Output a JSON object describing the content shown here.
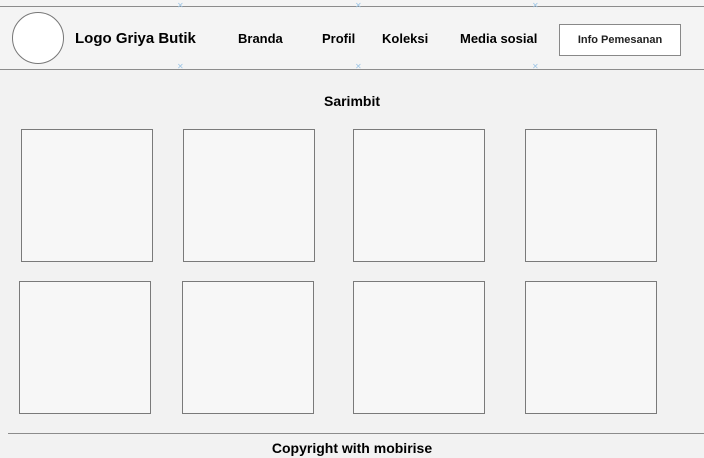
{
  "header": {
    "logo_text": "Logo Griya Butik",
    "nav": [
      "Branda",
      "Profil",
      "Koleksi",
      "Media sosial"
    ],
    "order_button": "Info Pemesanan"
  },
  "main": {
    "section_title": "Sarimbit",
    "tile_count": 8
  },
  "footer": {
    "copyright": "Copyright with mobirise"
  },
  "colors": {
    "background": "#f2f2f2",
    "border": "#7a7a7a",
    "guide_marker": "#9ec6e6"
  }
}
